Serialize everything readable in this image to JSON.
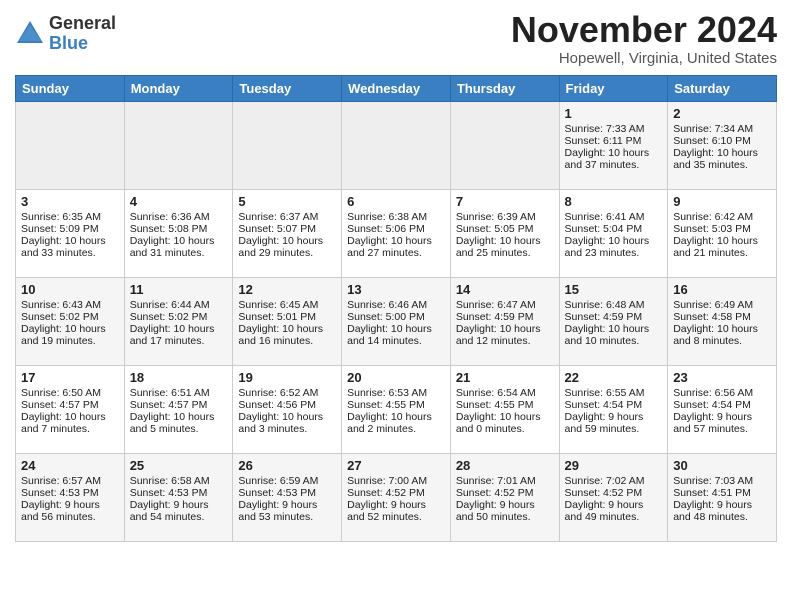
{
  "logo": {
    "general": "General",
    "blue": "Blue"
  },
  "header": {
    "month": "November 2024",
    "location": "Hopewell, Virginia, United States"
  },
  "weekdays": [
    "Sunday",
    "Monday",
    "Tuesday",
    "Wednesday",
    "Thursday",
    "Friday",
    "Saturday"
  ],
  "weeks": [
    [
      {
        "day": "",
        "empty": true
      },
      {
        "day": "",
        "empty": true
      },
      {
        "day": "",
        "empty": true
      },
      {
        "day": "",
        "empty": true
      },
      {
        "day": "",
        "empty": true
      },
      {
        "day": "1",
        "sunrise": "Sunrise: 7:33 AM",
        "sunset": "Sunset: 6:11 PM",
        "daylight": "Daylight: 10 hours and 37 minutes."
      },
      {
        "day": "2",
        "sunrise": "Sunrise: 7:34 AM",
        "sunset": "Sunset: 6:10 PM",
        "daylight": "Daylight: 10 hours and 35 minutes."
      }
    ],
    [
      {
        "day": "3",
        "sunrise": "Sunrise: 6:35 AM",
        "sunset": "Sunset: 5:09 PM",
        "daylight": "Daylight: 10 hours and 33 minutes."
      },
      {
        "day": "4",
        "sunrise": "Sunrise: 6:36 AM",
        "sunset": "Sunset: 5:08 PM",
        "daylight": "Daylight: 10 hours and 31 minutes."
      },
      {
        "day": "5",
        "sunrise": "Sunrise: 6:37 AM",
        "sunset": "Sunset: 5:07 PM",
        "daylight": "Daylight: 10 hours and 29 minutes."
      },
      {
        "day": "6",
        "sunrise": "Sunrise: 6:38 AM",
        "sunset": "Sunset: 5:06 PM",
        "daylight": "Daylight: 10 hours and 27 minutes."
      },
      {
        "day": "7",
        "sunrise": "Sunrise: 6:39 AM",
        "sunset": "Sunset: 5:05 PM",
        "daylight": "Daylight: 10 hours and 25 minutes."
      },
      {
        "day": "8",
        "sunrise": "Sunrise: 6:41 AM",
        "sunset": "Sunset: 5:04 PM",
        "daylight": "Daylight: 10 hours and 23 minutes."
      },
      {
        "day": "9",
        "sunrise": "Sunrise: 6:42 AM",
        "sunset": "Sunset: 5:03 PM",
        "daylight": "Daylight: 10 hours and 21 minutes."
      }
    ],
    [
      {
        "day": "10",
        "sunrise": "Sunrise: 6:43 AM",
        "sunset": "Sunset: 5:02 PM",
        "daylight": "Daylight: 10 hours and 19 minutes."
      },
      {
        "day": "11",
        "sunrise": "Sunrise: 6:44 AM",
        "sunset": "Sunset: 5:02 PM",
        "daylight": "Daylight: 10 hours and 17 minutes."
      },
      {
        "day": "12",
        "sunrise": "Sunrise: 6:45 AM",
        "sunset": "Sunset: 5:01 PM",
        "daylight": "Daylight: 10 hours and 16 minutes."
      },
      {
        "day": "13",
        "sunrise": "Sunrise: 6:46 AM",
        "sunset": "Sunset: 5:00 PM",
        "daylight": "Daylight: 10 hours and 14 minutes."
      },
      {
        "day": "14",
        "sunrise": "Sunrise: 6:47 AM",
        "sunset": "Sunset: 4:59 PM",
        "daylight": "Daylight: 10 hours and 12 minutes."
      },
      {
        "day": "15",
        "sunrise": "Sunrise: 6:48 AM",
        "sunset": "Sunset: 4:59 PM",
        "daylight": "Daylight: 10 hours and 10 minutes."
      },
      {
        "day": "16",
        "sunrise": "Sunrise: 6:49 AM",
        "sunset": "Sunset: 4:58 PM",
        "daylight": "Daylight: 10 hours and 8 minutes."
      }
    ],
    [
      {
        "day": "17",
        "sunrise": "Sunrise: 6:50 AM",
        "sunset": "Sunset: 4:57 PM",
        "daylight": "Daylight: 10 hours and 7 minutes."
      },
      {
        "day": "18",
        "sunrise": "Sunrise: 6:51 AM",
        "sunset": "Sunset: 4:57 PM",
        "daylight": "Daylight: 10 hours and 5 minutes."
      },
      {
        "day": "19",
        "sunrise": "Sunrise: 6:52 AM",
        "sunset": "Sunset: 4:56 PM",
        "daylight": "Daylight: 10 hours and 3 minutes."
      },
      {
        "day": "20",
        "sunrise": "Sunrise: 6:53 AM",
        "sunset": "Sunset: 4:55 PM",
        "daylight": "Daylight: 10 hours and 2 minutes."
      },
      {
        "day": "21",
        "sunrise": "Sunrise: 6:54 AM",
        "sunset": "Sunset: 4:55 PM",
        "daylight": "Daylight: 10 hours and 0 minutes."
      },
      {
        "day": "22",
        "sunrise": "Sunrise: 6:55 AM",
        "sunset": "Sunset: 4:54 PM",
        "daylight": "Daylight: 9 hours and 59 minutes."
      },
      {
        "day": "23",
        "sunrise": "Sunrise: 6:56 AM",
        "sunset": "Sunset: 4:54 PM",
        "daylight": "Daylight: 9 hours and 57 minutes."
      }
    ],
    [
      {
        "day": "24",
        "sunrise": "Sunrise: 6:57 AM",
        "sunset": "Sunset: 4:53 PM",
        "daylight": "Daylight: 9 hours and 56 minutes."
      },
      {
        "day": "25",
        "sunrise": "Sunrise: 6:58 AM",
        "sunset": "Sunset: 4:53 PM",
        "daylight": "Daylight: 9 hours and 54 minutes."
      },
      {
        "day": "26",
        "sunrise": "Sunrise: 6:59 AM",
        "sunset": "Sunset: 4:53 PM",
        "daylight": "Daylight: 9 hours and 53 minutes."
      },
      {
        "day": "27",
        "sunrise": "Sunrise: 7:00 AM",
        "sunset": "Sunset: 4:52 PM",
        "daylight": "Daylight: 9 hours and 52 minutes."
      },
      {
        "day": "28",
        "sunrise": "Sunrise: 7:01 AM",
        "sunset": "Sunset: 4:52 PM",
        "daylight": "Daylight: 9 hours and 50 minutes."
      },
      {
        "day": "29",
        "sunrise": "Sunrise: 7:02 AM",
        "sunset": "Sunset: 4:52 PM",
        "daylight": "Daylight: 9 hours and 49 minutes."
      },
      {
        "day": "30",
        "sunrise": "Sunrise: 7:03 AM",
        "sunset": "Sunset: 4:51 PM",
        "daylight": "Daylight: 9 hours and 48 minutes."
      }
    ]
  ]
}
